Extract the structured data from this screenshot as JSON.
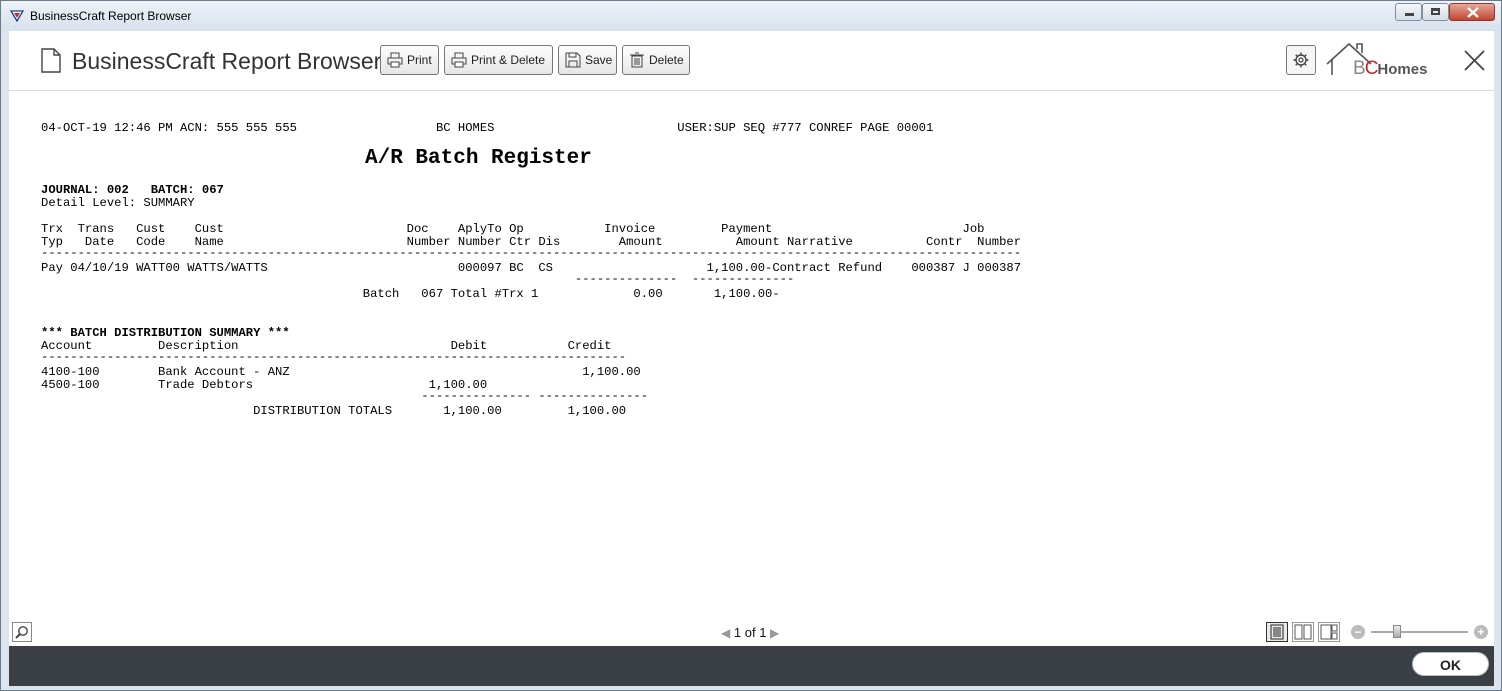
{
  "window": {
    "title": "BusinessCraft Report Browser"
  },
  "toolbar": {
    "app_title": "BusinessCraft Report Browser",
    "print_label": "Print",
    "print_delete_label": "Print & Delete",
    "save_label": "Save",
    "delete_label": "Delete",
    "logo": {
      "b": "B",
      "c": "C",
      "homes": "Homes"
    }
  },
  "report": {
    "header_line": "04-OCT-19 12:46 PM ACN: 555 555 555                   BC HOMES                         USER:SUP SEQ #777 CONREF PAGE 00001",
    "title": "A/R Batch Register",
    "journal_line": "JOURNAL: 002   BATCH: 067",
    "detail_level": "Detail Level: SUMMARY",
    "col_head_1": "Trx  Trans   Cust    Cust                         Doc    AplyTo Op           Invoice         Payment                          Job",
    "col_head_2": "Typ   Date   Code    Name                         Number Number Ctr Dis        Amount          Amount Narrative          Contr  Number",
    "rule_1": "--------------------------------------------------------------------------------------------------------------------------------------",
    "detail_row": "Pay 04/10/19 WATT00 WATTS/WATTS                          000097 BC  CS                     1,100.00-Contract Refund    000387 J 000387",
    "rule_2": "                                                                         --------------  --------------",
    "batch_total": "                                            Batch   067 Total #Trx 1             0.00       1,100.00-",
    "dist_title": "*** BATCH DISTRIBUTION SUMMARY ***",
    "dist_head": "Account         Description                             Debit           Credit",
    "rule_3": "--------------------------------------------------------------------------------",
    "dist_row_1": "4100-100        Bank Account - ANZ                                        1,100.00",
    "dist_row_2": "4500-100        Trade Debtors                        1,100.00",
    "rule_4": "                                                    --------------- ---------------",
    "dist_totals": "                             DISTRIBUTION TOTALS       1,100.00         1,100.00"
  },
  "footer": {
    "page_current": "1",
    "page_of": "of",
    "page_total": "1",
    "zoom_level_fraction": 0.25
  },
  "bottom": {
    "ok_label": "OK"
  }
}
